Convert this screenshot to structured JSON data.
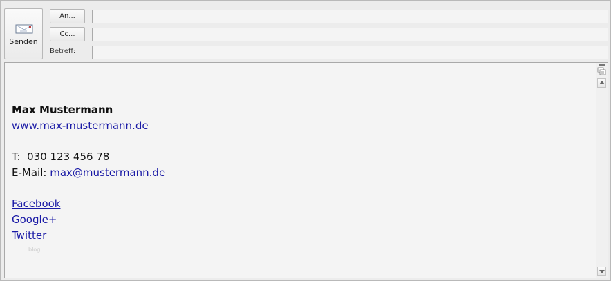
{
  "header": {
    "send_label": "Senden",
    "to_label": "An...",
    "cc_label": "Cc...",
    "subject_label": "Betreff:",
    "to_value": "",
    "cc_value": "",
    "subject_value": ""
  },
  "signature": {
    "name": "Max Mustermann",
    "website": "www.max-mustermann.de",
    "phone_label": "T:",
    "phone": "030 123 456 78",
    "email_label": "E-Mail:",
    "email": "max@mustermann.de",
    "social": [
      "Facebook",
      "Google+",
      "Twitter"
    ],
    "blog_faint": "blog"
  },
  "icons": {
    "send": "envelope-send-icon",
    "scroll_up": "chevron-up-icon",
    "scroll_down": "chevron-down-icon",
    "options": "scroll-options-icon"
  },
  "colors": {
    "link": "#1a1aa6",
    "background": "#ececec",
    "body": "#f4f4f4"
  }
}
